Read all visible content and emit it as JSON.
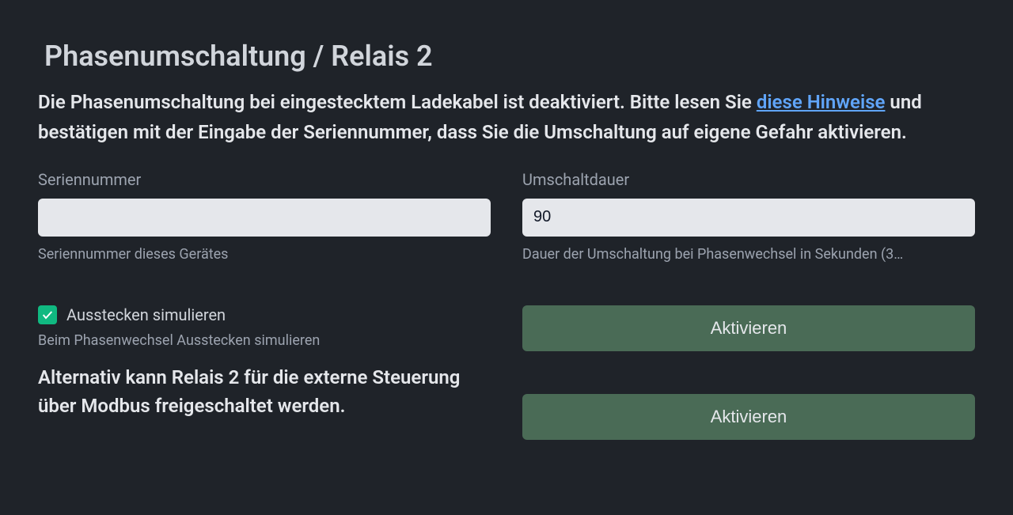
{
  "page": {
    "title": "Phasenumschaltung / Relais 2"
  },
  "description": {
    "text_before_link": "Die Phasenumschaltung bei eingestecktem Ladekabel ist deaktiviert. Bitte lesen Sie ",
    "link_text": "diese Hinweise",
    "text_after_link": " und bestätigen mit der Eingabe der Seriennummer, dass Sie die Umschaltung auf eigene Gefahr aktivieren."
  },
  "fields": {
    "serial": {
      "label": "Seriennummer",
      "value": "",
      "help": "Seriennummer dieses Gerätes"
    },
    "duration": {
      "label": "Umschaltdauer",
      "value": "90",
      "help": "Dauer der Umschaltung bei Phasenwechsel in Sekunden (3…"
    }
  },
  "checkbox": {
    "checked": true,
    "label": "Ausstecken simulieren",
    "help": "Beim Phasenwechsel Ausstecken simulieren"
  },
  "secondary_description": "Alternativ kann Relais 2 für die externe Steuerung über Modbus freigeschaltet werden.",
  "buttons": {
    "activate_phase": "Aktivieren",
    "activate_modbus": "Aktivieren"
  }
}
